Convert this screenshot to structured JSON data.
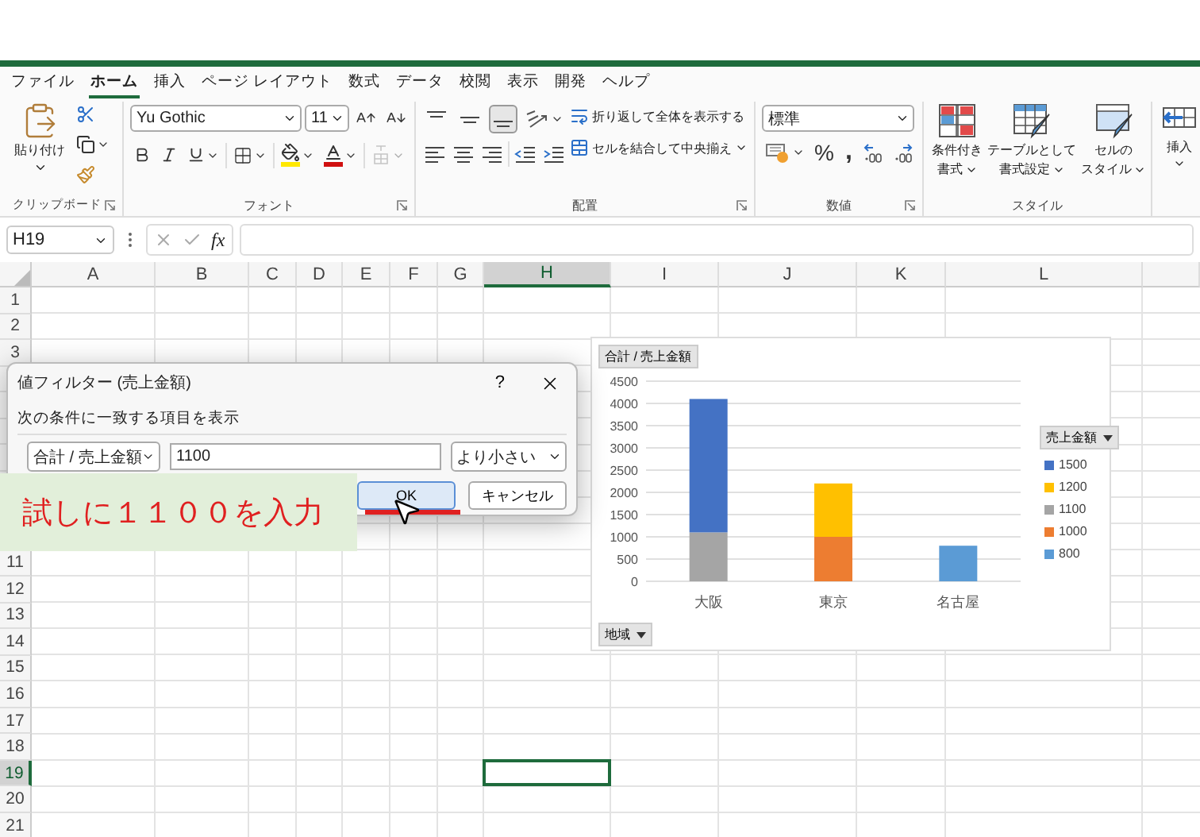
{
  "menu_tabs": [
    {
      "label": "ファイル",
      "selected": false
    },
    {
      "label": "ホーム",
      "selected": true
    },
    {
      "label": "挿入",
      "selected": false
    },
    {
      "label": "ページ レイアウト",
      "selected": false
    },
    {
      "label": "数式",
      "selected": false
    },
    {
      "label": "データ",
      "selected": false
    },
    {
      "label": "校閲",
      "selected": false
    },
    {
      "label": "表示",
      "selected": false
    },
    {
      "label": "開発",
      "selected": false
    },
    {
      "label": "ヘルプ",
      "selected": false
    }
  ],
  "ribbon": {
    "clipboard": {
      "paste_label": "貼り付け",
      "group_label": "クリップボード"
    },
    "font": {
      "font_name": "Yu Gothic",
      "font_size": "11",
      "furigana_disabled": true,
      "group_label": "フォント"
    },
    "alignment": {
      "vertical_align": [
        {
          "selected": false
        },
        {
          "selected": false
        },
        {
          "selected": true
        }
      ],
      "wrap_text": "折り返して全体を表示する",
      "merge_center": "セルを結合して中央揃え",
      "group_label": "配置"
    },
    "number": {
      "format": "標準",
      "percent": "%",
      "comma": ",",
      "group_label": "数値"
    },
    "styles": {
      "buttons": [
        {
          "kind": "conditional",
          "line1": "条件付き",
          "line2": "書式"
        },
        {
          "kind": "table",
          "line1": "テーブルとして",
          "line2": "書式設定"
        },
        {
          "kind": "cell",
          "line1": "セルの",
          "line2": "スタイル"
        }
      ],
      "group_label": "スタイル"
    },
    "cells": {
      "insert": "挿入"
    }
  },
  "formula_bar": {
    "name_box": "H19",
    "fx": "fx"
  },
  "columns": [
    {
      "label": "A",
      "selected": false
    },
    {
      "label": "B",
      "selected": false
    },
    {
      "label": "C",
      "selected": false
    },
    {
      "label": "D",
      "selected": false
    },
    {
      "label": "E",
      "selected": false
    },
    {
      "label": "F",
      "selected": false
    },
    {
      "label": "G",
      "selected": false
    },
    {
      "label": "H",
      "selected": true
    },
    {
      "label": "I",
      "selected": false
    },
    {
      "label": "J",
      "selected": false
    },
    {
      "label": "K",
      "selected": false
    },
    {
      "label": "L",
      "selected": false
    }
  ],
  "rows_above_dialog": [
    {
      "label": "1",
      "selected": false
    },
    {
      "label": "2",
      "selected": false
    },
    {
      "label": "3",
      "selected": false
    }
  ],
  "rows_below_dialog": [
    {
      "label": "11",
      "selected": false
    },
    {
      "label": "12",
      "selected": false
    },
    {
      "label": "13",
      "selected": false
    },
    {
      "label": "14",
      "selected": false
    },
    {
      "label": "15",
      "selected": false
    },
    {
      "label": "16",
      "selected": false
    },
    {
      "label": "17",
      "selected": false
    },
    {
      "label": "18",
      "selected": false
    },
    {
      "label": "19",
      "selected": true
    },
    {
      "label": "20",
      "selected": false
    },
    {
      "label": "21",
      "selected": false
    }
  ],
  "dialog": {
    "title": "値フィルター (売上金額)",
    "help": "?",
    "prompt": "次の条件に一致する項目を表示",
    "field_select": "合計 / 売上金額",
    "value": "1100",
    "operator": "より小さい",
    "buttons": [
      {
        "label": "OK",
        "focused": true
      },
      {
        "label": "キャンセル",
        "focused": false
      }
    ]
  },
  "callout": "試しに１１００を入力",
  "chart": {
    "field_value": "合計 / 売上金額",
    "field_legend": "売上金額",
    "field_axis": "地域",
    "chart_data": {
      "type": "bar",
      "stacked": true,
      "categories": [
        "大阪",
        "東京",
        "名古屋"
      ],
      "series": [
        {
          "name": "1500",
          "color": "#4472c4",
          "values": [
            3000,
            null,
            null
          ]
        },
        {
          "name": "1200",
          "color": "#ffc000",
          "values": [
            null,
            1200,
            null
          ]
        },
        {
          "name": "1100",
          "color": "#a5a5a5",
          "values": [
            1100,
            null,
            null
          ]
        },
        {
          "name": "1000",
          "color": "#ed7d31",
          "values": [
            null,
            1000,
            null
          ]
        },
        {
          "name": "800",
          "color": "#5b9bd5",
          "values": [
            null,
            null,
            800
          ]
        }
      ],
      "grid": true,
      "legend": true,
      "ylim": [
        0,
        4500
      ],
      "yticks": [
        0,
        500,
        1000,
        1500,
        2000,
        2500,
        3000,
        3500,
        4000,
        4500
      ]
    }
  }
}
